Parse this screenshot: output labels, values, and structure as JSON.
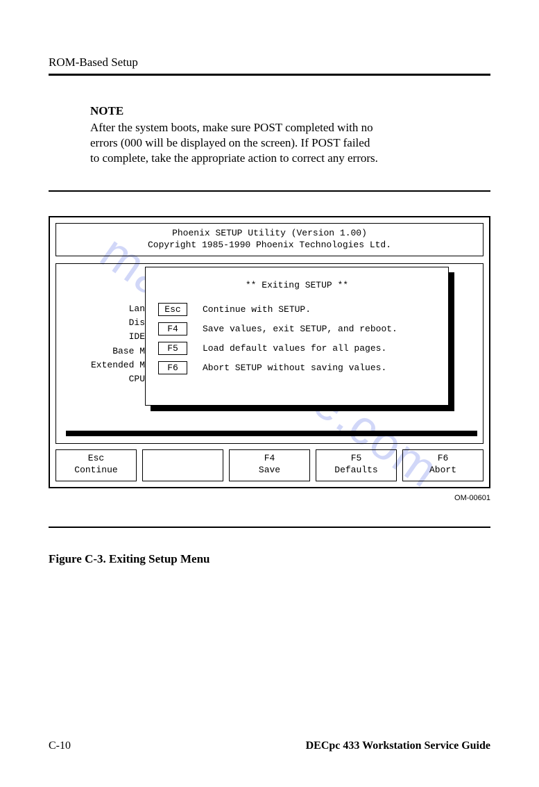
{
  "header": {
    "running_head": "ROM-Based Setup"
  },
  "note": {
    "label": "NOTE",
    "body": "After the system boots, make sure POST completed with no errors (000 will be displayed on the screen). If POST failed to complete, take the appropriate action to correct any errors."
  },
  "bios": {
    "title_line1": "Phoenix SETUP Utility (Version 1.00)",
    "title_line2": "Copyright 1985-1990  Phoenix Technologies Ltd.",
    "bg_labels": [
      "Lan",
      "Dis",
      "IDE",
      "Base M",
      "Extended M",
      "CPU"
    ],
    "popup": {
      "title": "** Exiting SETUP **",
      "rows": [
        {
          "key": "Esc",
          "desc": "Continue with SETUP."
        },
        {
          "key": "F4",
          "desc": "Save values, exit SETUP, and reboot."
        },
        {
          "key": "F5",
          "desc": "Load default values for all pages."
        },
        {
          "key": "F6",
          "desc": "Abort SETUP without saving values."
        }
      ]
    },
    "fkeys": [
      {
        "key": "Esc",
        "label": "Continue"
      },
      {
        "key": "",
        "label": ""
      },
      {
        "key": "F4",
        "label": "Save"
      },
      {
        "key": "F5",
        "label": "Defaults"
      },
      {
        "key": "F6",
        "label": "Abort"
      }
    ],
    "om_id": "OM-00601"
  },
  "figure_caption": "Figure C-3.  Exiting Setup Menu",
  "footer": {
    "page_num": "C-10",
    "book_title": "DECpc 433 Workstation Service Guide"
  },
  "watermark": "manualshive.com"
}
